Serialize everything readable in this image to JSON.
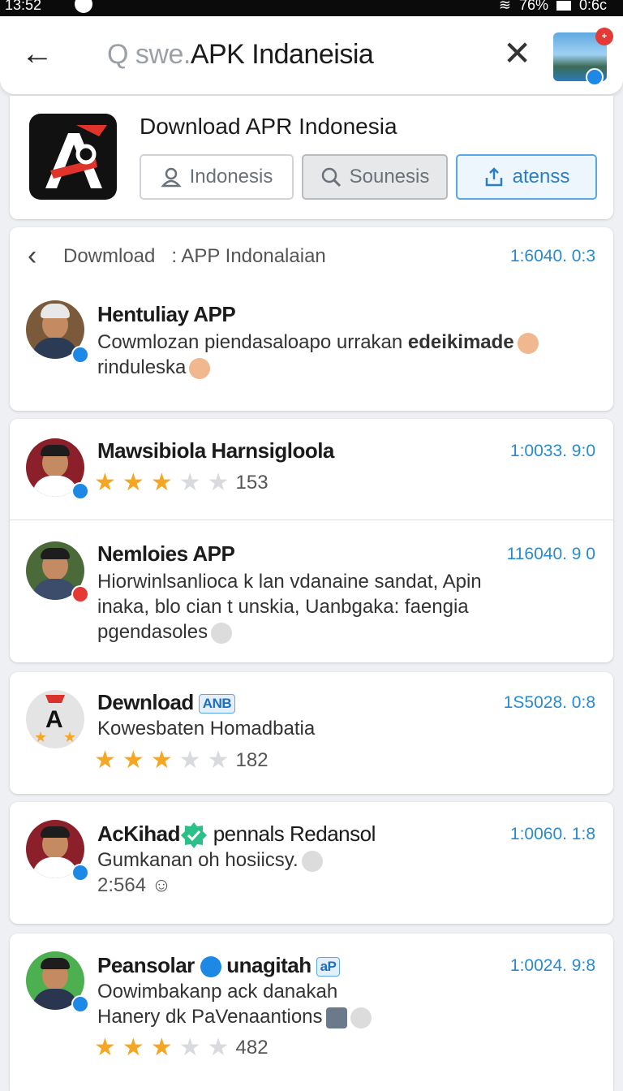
{
  "status": {
    "time": "13:52",
    "battery": "76%",
    "clock_right": "0:6c"
  },
  "search": {
    "prefix": "Q swe.",
    "query": "APK Indaneisia",
    "clear": "✕",
    "back": "←"
  },
  "top_app": {
    "title": "Download APR Indonesia",
    "chips": [
      {
        "label": "Indonesis",
        "icon": "person-icon"
      },
      {
        "label": "Sounesis",
        "icon": "search-icon"
      },
      {
        "label": "atenss",
        "icon": "share-icon"
      }
    ]
  },
  "crumb": {
    "back": "‹",
    "label": "Dowmload   : APP Indonalaian",
    "time": "1:6040. 0:3"
  },
  "items": [
    {
      "name": "Hentuliay APP",
      "desc_a": "Cowmlozan piendasaloapo urrakan ",
      "desc_b": "edeikimade",
      "desc_c": "rinduleska",
      "time": "",
      "badge": "blue"
    },
    {
      "name": "Mawsibiola  Harnsigloola",
      "rating": 3,
      "count": "153",
      "time": "1:0033. 9:0",
      "badge": "blue"
    },
    {
      "name": "Nemloies APP",
      "desc": [
        "Hiorwinlsanlioca k lan vdanaine sandat, Apin",
        "inaka, blo cian t unskia, Uanbgaka: faengia",
        "pgendasoles"
      ],
      "time": "116040. 9 0",
      "badge": "red"
    },
    {
      "name": "Dewnload",
      "tag": "ANB",
      "desc": [
        "Kowesbaten Homadbatia"
      ],
      "rating": 3,
      "count": "182",
      "time": "1S5028. 0:8",
      "badge": "none"
    },
    {
      "name_a": "AcKihad",
      "name_b": " pennals Redansol",
      "desc": [
        "Gumkanan oh hosiicsy.",
        "2:564"
      ],
      "time": "1:0060. 1:8",
      "badge": "blue"
    },
    {
      "name_a": "Peansolar",
      "name_b": " unagitah",
      "tag": "aP",
      "desc": [
        "Oowimbakanp ack danakah",
        "Hanery dk PaVenaantions"
      ],
      "rating": 3,
      "count": "482",
      "time": "1:0024. 9:8",
      "badge": "blue"
    }
  ]
}
